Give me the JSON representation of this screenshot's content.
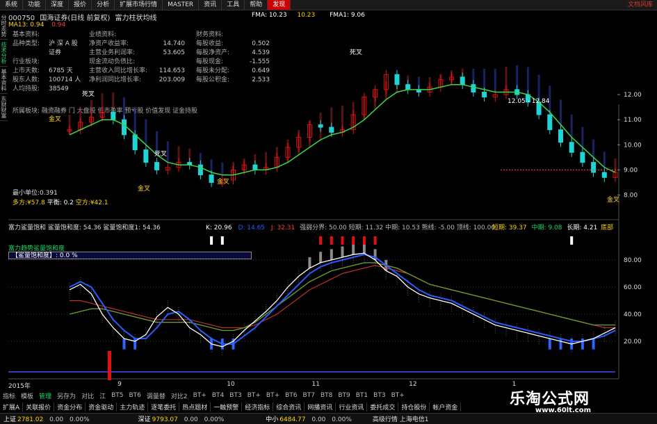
{
  "menu": {
    "items": [
      "系统",
      "功能",
      "深度",
      "报价",
      "分析",
      "扩展市场行情",
      "MASTER",
      "资讯",
      "工具",
      "帮助",
      "发现"
    ],
    "active_index": 10,
    "right_text": "文档风库"
  },
  "title": {
    "code": "000750",
    "name": "国海证券(日线 前复权)",
    "indicator": "富力柱状均线"
  },
  "left_tabs": [
    "分时走势",
    "技术分析",
    "基本资料",
    "东财财富"
  ],
  "left_tabs_active": 1,
  "ma": {
    "ma13_label": "MA13: 0.94",
    "ma13_extra": "0.94",
    "fma1": "FMA: 10.23",
    "fma2": "10.23",
    "fma3": "FMA1: 9.06"
  },
  "basic_info": {
    "header": "基本资料:",
    "rows": [
      {
        "k": "品种类型:",
        "v": "沪 深 A 股"
      },
      {
        "k": "",
        "v": "证券"
      },
      {
        "k": "行业板块:",
        "v": ""
      },
      {
        "k": "上市天数:",
        "v": "6785 天"
      },
      {
        "k": "股东人数:",
        "v": "100714 人"
      },
      {
        "k": "人均持股:",
        "v": "38549"
      }
    ]
  },
  "perf_info": {
    "header": "业绩资料:",
    "rows": [
      {
        "k": "净资产收益率:",
        "v": "14.740"
      },
      {
        "k": "主营业务利润率:",
        "v": "53.605"
      },
      {
        "k": "现金流动负债比:",
        "v": ""
      },
      {
        "k": "主营收入同比增长率:",
        "v": "114.653"
      },
      {
        "k": "净利润同比增长率:",
        "v": "203.009"
      }
    ]
  },
  "fin_info": {
    "header": "财务资料:",
    "rows": [
      {
        "k": "每股收益:",
        "v": "0.502"
      },
      {
        "k": "每股净资产:",
        "v": "4.539"
      },
      {
        "k": "每股现金:",
        "v": "-1.555"
      },
      {
        "k": "每股未分配:",
        "v": "0.649"
      },
      {
        "k": "每股公积金:",
        "v": "2.533"
      }
    ]
  },
  "sector_line": "所属板块: 融资融券  门  大盘股  低市盈率  预亏股  价值发现  证金持股",
  "chart_labels": {
    "death_cross": "死叉",
    "golden_cross": "金叉",
    "range_text": "12.05 - 12.84",
    "min_unit": "最小单位:0.391",
    "force_a": "多方:¥57.8",
    "force_b": "平衡: 0.2",
    "force_c": "空方:¥42.1"
  },
  "indicator_row": {
    "left": "富力鲨量饱和  鲨量饱和度: 54.36  鲨量饱和度1: 54.36",
    "k": "K: 20.96",
    "d": "D: 14.65",
    "j": "J: 32.31",
    "mid": "强弱分界: 50.00  短期: 11.32  中期: 10.53  熊线: -5.00  顶线: 100.00",
    "short": "短期: 39.37",
    "middle": "中期: 9.08",
    "long": "长期: 4.21",
    "tail": "底部"
  },
  "oscillator": {
    "label": "富力趋势鲨量饱和度",
    "box_text": "【鲨量饱和度】: 0.0 %"
  },
  "price_axis": [
    "12.00",
    "11.00",
    "10.00",
    "9.00",
    "8.00"
  ],
  "osc_axis": [
    "80.00",
    "60.00",
    "40.00",
    "20.00"
  ],
  "date_axis": [
    {
      "t": "2015年",
      "pos": 0.0
    },
    {
      "t": "9",
      "pos": 0.18
    },
    {
      "t": "10",
      "pos": 0.36
    },
    {
      "t": "11",
      "pos": 0.5
    },
    {
      "t": "12",
      "pos": 0.66
    },
    {
      "t": "1",
      "pos": 0.83
    }
  ],
  "toolbar": {
    "items": [
      "指标",
      "模板",
      "管理",
      "另存为",
      "对比",
      "江",
      "BT5",
      "BT6",
      "调量替",
      "对比2",
      "BT+",
      "BT4",
      "BT3",
      "BT+",
      "BT+",
      "BT6",
      "BT7",
      "BT8",
      "BT9",
      "BT1",
      "BT3",
      "BT+"
    ],
    "active_index": 2
  },
  "funcbar": [
    "扩展A",
    "关联报价",
    "资金分布",
    "资金驱动",
    "主力轨迹",
    "逐笔委托",
    "热点题材",
    "一触预警",
    "经济指标",
    "综合资讯",
    "网播资讯",
    "行业资讯",
    "委托成交",
    "持仓股份",
    "帐户资金"
  ],
  "status": {
    "sh": {
      "name": "上证",
      "v": "2781.02",
      "c": "0.00",
      "p": "0.00%"
    },
    "sz": {
      "name": "深证",
      "v": "9793.07",
      "c": "0.00",
      "p": "0.00%"
    },
    "zx": {
      "name": "中小",
      "v": "6484.77",
      "c": "0.00",
      "p": "0.00%"
    },
    "tail": "高级行情 上海电信1"
  },
  "brand": {
    "name": "乐淘公式网",
    "url": "www.60lt.com"
  },
  "colors": {
    "up": "#e01010",
    "down": "#1fd4d4",
    "ma_green": "#3ad84a",
    "blue_line": "#2a5cff"
  },
  "chart_data": {
    "type": "line",
    "price": {
      "ylim": [
        7.6,
        13.0
      ],
      "close": [
        10.6,
        10.9,
        11.1,
        11.3,
        11.0,
        10.4,
        9.8,
        9.3,
        9.0,
        9.1,
        9.3,
        9.2,
        8.8,
        8.5,
        8.6,
        9.0,
        9.2,
        9.0,
        9.1,
        9.5,
        9.9,
        10.3,
        10.8,
        10.7,
        10.5,
        10.6,
        11.2,
        11.9,
        12.2,
        12.8,
        12.4,
        12.2,
        12.1,
        12.3,
        12.6,
        12.7,
        12.4,
        12.1,
        11.9,
        12.0,
        12.2,
        12.0,
        11.7,
        11.2,
        10.6,
        10.1,
        9.7,
        9.3,
        8.9,
        8.7,
        8.9
      ],
      "ma": [
        10.4,
        10.6,
        10.8,
        11.0,
        11.0,
        10.8,
        10.4,
        10.0,
        9.6,
        9.3,
        9.2,
        9.2,
        9.1,
        8.9,
        8.8,
        8.8,
        8.9,
        9.0,
        9.0,
        9.1,
        9.3,
        9.6,
        9.9,
        10.2,
        10.4,
        10.5,
        10.7,
        11.0,
        11.4,
        11.8,
        12.1,
        12.2,
        12.2,
        12.2,
        12.3,
        12.4,
        12.4,
        12.3,
        12.2,
        12.1,
        12.1,
        12.1,
        12.0,
        11.7,
        11.3,
        10.8,
        10.3,
        9.9,
        9.5,
        9.1,
        8.9
      ]
    },
    "osc": {
      "ylim": [
        0,
        100
      ],
      "white": [
        58,
        62,
        55,
        40,
        30,
        22,
        20,
        25,
        38,
        45,
        40,
        30,
        25,
        18,
        16,
        20,
        28,
        35,
        42,
        50,
        60,
        68,
        74,
        78,
        80,
        82,
        84,
        85,
        80,
        72,
        68,
        60,
        55,
        52,
        50,
        48,
        44,
        40,
        36,
        32,
        30,
        28,
        26,
        24,
        22,
        20,
        18,
        20,
        22,
        26,
        30
      ],
      "blue": [
        60,
        64,
        60,
        48,
        36,
        28,
        22,
        22,
        30,
        40,
        42,
        36,
        28,
        22,
        18,
        18,
        24,
        30,
        38,
        46,
        54,
        62,
        70,
        75,
        78,
        80,
        82,
        84,
        82,
        76,
        70,
        64,
        58,
        54,
        52,
        50,
        46,
        42,
        38,
        34,
        32,
        30,
        28,
        26,
        24,
        22,
        20,
        20,
        22,
        24,
        28
      ],
      "green": [
        40,
        42,
        44,
        44,
        42,
        40,
        38,
        36,
        34,
        34,
        34,
        34,
        32,
        30,
        28,
        28,
        30,
        34,
        40,
        46,
        52,
        58,
        64,
        68,
        72,
        74,
        76,
        78,
        78,
        76,
        74,
        70,
        66,
        62,
        60,
        58,
        56,
        54,
        52,
        50,
        48,
        46,
        44,
        42,
        40,
        38,
        36,
        34,
        32,
        32,
        32
      ],
      "red": [
        50,
        50,
        48,
        46,
        44,
        42,
        40,
        38,
        36,
        36,
        36,
        36,
        34,
        32,
        30,
        30,
        30,
        32,
        36,
        40,
        46,
        52,
        58,
        62,
        66,
        70,
        72,
        74,
        76,
        74,
        72,
        70,
        66,
        62,
        60,
        58,
        56,
        54,
        52,
        50,
        48,
        46,
        44,
        42,
        40,
        38,
        36,
        34,
        32,
        30,
        30
      ]
    }
  }
}
